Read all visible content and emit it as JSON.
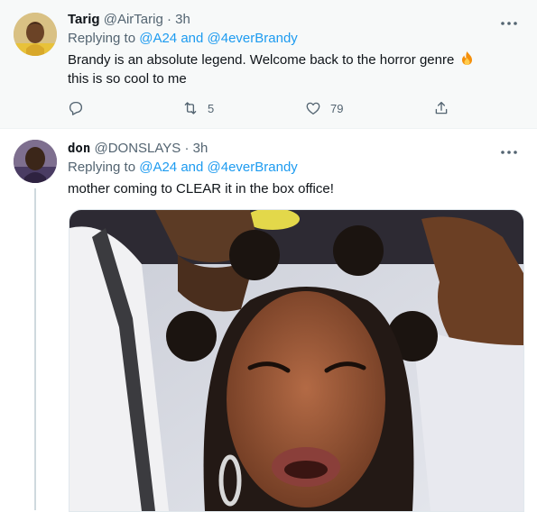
{
  "tweets": [
    {
      "display_name": "Tarig",
      "handle": "@AirTarig",
      "separator": "·",
      "time": "3h",
      "replying_prefix": "Replying to",
      "replying_to": [
        "@A24",
        "@4everBrandy"
      ],
      "replying_and": "and",
      "text_part1": "Brandy is an absolute legend. Welcome back to the horror genre",
      "text_part2": "this is so cool to me",
      "emoji": "fire-emoji",
      "actions": {
        "reply_icon": "reply-icon",
        "retweet_icon": "retweet-icon",
        "retweet_count": "5",
        "like_icon": "heart-icon",
        "like_count": "79",
        "share_icon": "share-icon"
      }
    },
    {
      "display_name": "don",
      "handle": "@DONSLAYS",
      "separator": "·",
      "time": "3h",
      "replying_prefix": "Replying to",
      "replying_to": [
        "@A24",
        "@4everBrandy"
      ],
      "replying_and": "and",
      "text": "mother coming to CLEAR it in the box office!",
      "media": "video-thumbnail"
    }
  ],
  "colors": {
    "accent": "#1d9bf0",
    "secondary_text": "#536471",
    "highlight_bg": "#f7f9f9"
  }
}
